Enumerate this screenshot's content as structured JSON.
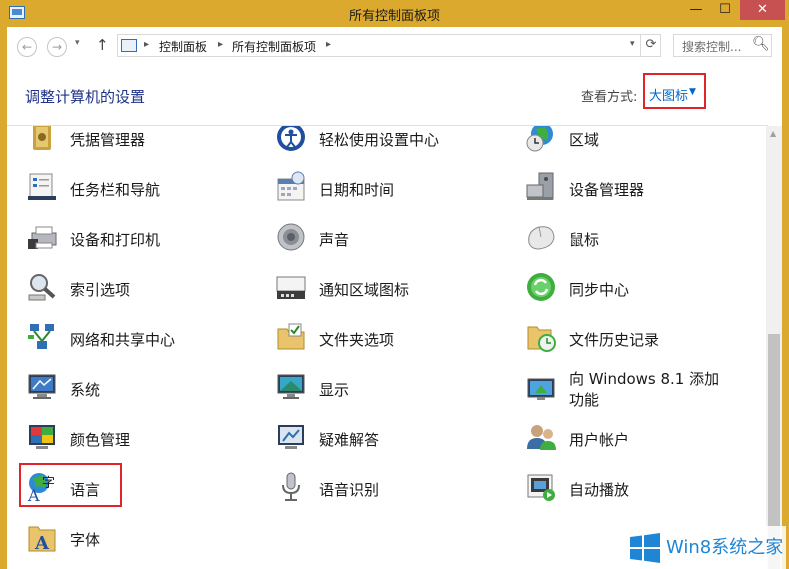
{
  "window": {
    "title": "所有控制面板项",
    "min_label": "—",
    "max_label": "☐",
    "close_label": "✕"
  },
  "navbar": {
    "back_label": "←",
    "forward_label": "→",
    "history_label": "▾",
    "up_label": "↑",
    "address": {
      "crumb1": "控制面板",
      "crumb2": "所有控制面板项",
      "sep": "▸",
      "dropdown_label": "▾",
      "refresh_label": "⟳"
    },
    "search": {
      "placeholder": "搜索控制...",
      "icon_label": "🔍︎"
    }
  },
  "header": {
    "page_title": "调整计算机的设置",
    "view_label": "查看方式:",
    "view_value": "大图标",
    "view_caret": "▼"
  },
  "items": [
    {
      "label": "凭据管理器",
      "icon": "credential-manager-icon"
    },
    {
      "label": "轻松使用设置中心",
      "icon": "ease-of-access-icon"
    },
    {
      "label": "区域",
      "icon": "region-icon"
    },
    {
      "label": "任务栏和导航",
      "icon": "taskbar-icon"
    },
    {
      "label": "日期和时间",
      "icon": "date-time-icon"
    },
    {
      "label": "设备管理器",
      "icon": "device-manager-icon"
    },
    {
      "label": "设备和打印机",
      "icon": "devices-printers-icon"
    },
    {
      "label": "声音",
      "icon": "sound-icon"
    },
    {
      "label": "鼠标",
      "icon": "mouse-icon"
    },
    {
      "label": "索引选项",
      "icon": "indexing-icon"
    },
    {
      "label": "通知区域图标",
      "icon": "notification-icons-icon"
    },
    {
      "label": "同步中心",
      "icon": "sync-center-icon"
    },
    {
      "label": "网络和共享中心",
      "icon": "network-icon"
    },
    {
      "label": "文件夹选项",
      "icon": "folder-options-icon"
    },
    {
      "label": "文件历史记录",
      "icon": "file-history-icon"
    },
    {
      "label": "系统",
      "icon": "system-icon"
    },
    {
      "label": "显示",
      "icon": "display-icon"
    },
    {
      "label": "向 Windows 8.1 添加功能",
      "icon": "add-features-icon"
    },
    {
      "label": "颜色管理",
      "icon": "color-management-icon"
    },
    {
      "label": "疑难解答",
      "icon": "troubleshooting-icon"
    },
    {
      "label": "用户帐户",
      "icon": "user-accounts-icon"
    },
    {
      "label": "语言",
      "icon": "language-icon"
    },
    {
      "label": "语音识别",
      "icon": "speech-recognition-icon"
    },
    {
      "label": "自动播放",
      "icon": "autoplay-icon"
    },
    {
      "label": "字体",
      "icon": "fonts-icon"
    }
  ],
  "scrollbar": {
    "up_label": "▲"
  },
  "watermark": {
    "text": "Win8系统之家"
  },
  "colors": {
    "title_bar": "#dba92d",
    "link": "#0066cc",
    "highlight": "#e0242a",
    "page_title": "#1e3287"
  }
}
